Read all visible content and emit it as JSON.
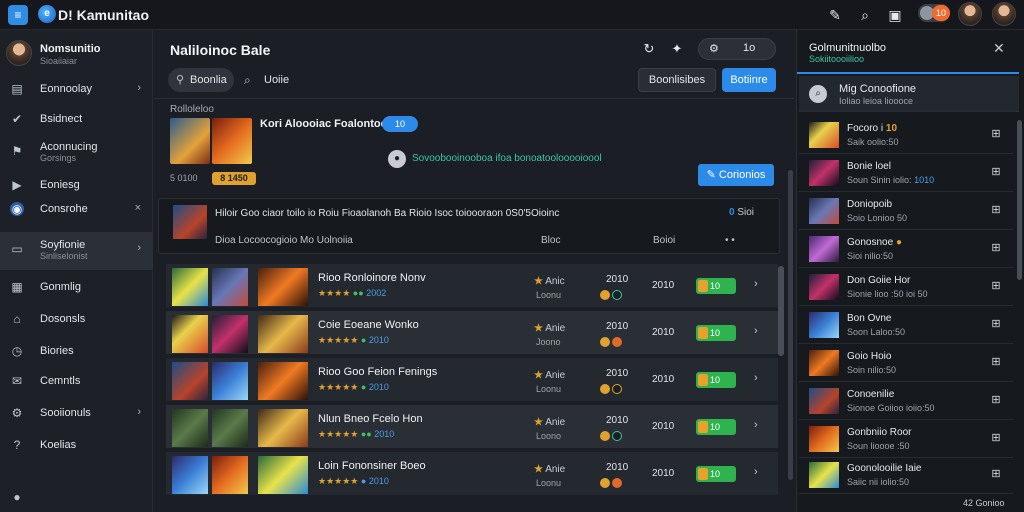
{
  "app": {
    "title": "D! Kamunitao",
    "icon": "app-icon",
    "logo": "circle-logo"
  },
  "topbar": {
    "badge": "10",
    "icons": [
      "edit-icon",
      "search-icon",
      "gift-icon",
      "toggle-icon"
    ]
  },
  "sidebar": {
    "profile": {
      "name": "Nomsunitio",
      "sub": "Sioaiiaiar"
    },
    "items": [
      {
        "label": "Eonnoolay",
        "icon": "clipboard-icon",
        "chevron": "›"
      },
      {
        "label": "Bsidnect",
        "icon": "check-circle-icon"
      },
      {
        "label": "Aconnucing",
        "sub": "Gorsings",
        "icon": "bookmark-icon"
      },
      {
        "label": "Eoniesg",
        "icon": "play-icon"
      },
      {
        "label": "Consrohe",
        "icon": "globe-icon",
        "chevron": "×"
      },
      {
        "label": "Soyfionie",
        "sub": "Sinliselonist",
        "icon": "folder-icon",
        "chevron": "›"
      },
      {
        "label": "Gonmlig",
        "icon": "chart-icon"
      },
      {
        "label": "Dosonsls",
        "icon": "home-icon"
      },
      {
        "label": "Biories",
        "icon": "clock-icon"
      },
      {
        "label": "Cemntls",
        "icon": "mail-icon"
      },
      {
        "label": "Sooiionuls",
        "icon": "settings-icon",
        "chevron": "›"
      },
      {
        "label": "Koelias",
        "icon": "help-icon"
      }
    ]
  },
  "main": {
    "title": "Naliloinoc Bale",
    "header_pill": {
      "left": "⚙",
      "right": "1o"
    },
    "seg_button": "Boonlia",
    "search_label": "Uoiie",
    "outline_button": "Boonlisibes",
    "primary_button": "Botiinre",
    "section_label": "Rolloleloo",
    "featured": {
      "title": "Kori Aloooiac Foalontoo",
      "chip": "10",
      "meta": "5 0100",
      "tag": "8 1450",
      "notice": "Sovoobooinooboa ifoa bonoatoolooooioool",
      "cta": "Corionios"
    },
    "info": {
      "line": "Hiloir Goo ciaor toilo io Roiu Fioaolanoh Ba Rioio Isoc toioooraon 0S0'5Oioinc",
      "badge_num": "0",
      "badge_text": "Sioi",
      "col_title": "Dioa Locoocogioio  Mo Uolnoiia",
      "col_a": "Bloc",
      "col_b": "Boioi",
      "col_c": "• •"
    },
    "rows": [
      {
        "title": "Rioo Ronloinore Nonv",
        "stars": "★★★★",
        "meta": "2002",
        "cat": "Anic",
        "sub": "Loonu",
        "score": "2010",
        "year": "2010",
        "badge": "10"
      },
      {
        "title": "Coie Eoeane Wonko",
        "stars": "★★★★★",
        "meta": "2010",
        "cat": "Anie",
        "sub": "Joono",
        "score": "2010",
        "year": "2010",
        "badge": "10"
      },
      {
        "title": "Rioo Goo Feion Fenings",
        "stars": "★★★★★",
        "meta": "2010",
        "cat": "Anie",
        "sub": "Loonu",
        "score": "2010",
        "year": "2010",
        "badge": "10"
      },
      {
        "title": "Nlun Bneo Fcelo Hon",
        "stars": "★★★★★",
        "meta": "2010",
        "cat": "Anie",
        "sub": "Loono",
        "score": "2010",
        "year": "2010",
        "badge": "10"
      },
      {
        "title": "Loin Fononsiner Boeo",
        "stars": "★★★★★",
        "meta": "2010",
        "cat": "Anie",
        "sub": "Loonu",
        "score": "2010",
        "year": "2010",
        "badge": "10"
      }
    ]
  },
  "rpanel": {
    "title": "Golmunitnuolbo",
    "sub": "Sokiitoooiilioo",
    "search": {
      "text": "Mig Conoofione",
      "sub": "Ioliao leioa lioooce"
    },
    "items": [
      {
        "title": "Focoro i",
        "highlight": "10",
        "sub": "Saik oolio:50"
      },
      {
        "title": "Bonie loel",
        "sub": "Soun Sinin iolio:",
        "sub_highlight": "1010"
      },
      {
        "title": "Doniopoib",
        "sub": "Soio Lonioo 50"
      },
      {
        "title": "Gonosnoe",
        "highlight": "●",
        "sub": "Sioi nilio:50"
      },
      {
        "title": "Don Goiie Hor",
        "sub": "Sionie lioo :50 ioi 50"
      },
      {
        "title": "Bon Ovne",
        "sub": "Soon Laloo:50"
      },
      {
        "title": "Goio Hoio",
        "sub": "Soin nilio:50"
      },
      {
        "title": "Conoenilie",
        "sub": "Sionoe Goiioo ioiio:50"
      },
      {
        "title": "Gonbniio Roor",
        "sub": "Soun lioooe :50"
      },
      {
        "title": "Goonolooilie Iaie",
        "sub": "Saiic nii iolio:50"
      }
    ],
    "footer": "42  Gonioo"
  },
  "colors": {
    "accent": "#2c8be8",
    "teal": "#3dc6a7",
    "gold": "#e0a22f",
    "green": "#2fb34f"
  }
}
